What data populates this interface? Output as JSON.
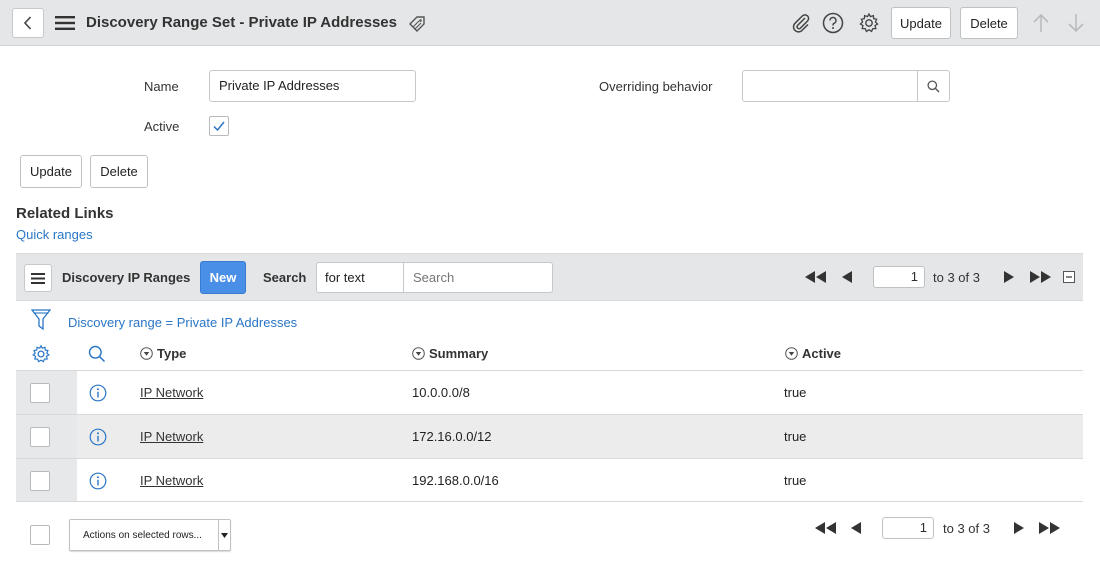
{
  "header": {
    "title": "Discovery Range Set - Private IP Addresses",
    "update_label": "Update",
    "delete_label": "Delete"
  },
  "form": {
    "name_label": "Name",
    "name_value": "Private IP Addresses",
    "active_label": "Active",
    "active_checked": true,
    "overriding_label": "Overriding behavior",
    "overriding_value": "",
    "update_label": "Update",
    "delete_label": "Delete"
  },
  "related": {
    "heading": "Related Links",
    "quick_ranges": "Quick ranges"
  },
  "list": {
    "title": "Discovery IP Ranges",
    "new_label": "New",
    "search_label": "Search",
    "search_field": "for text",
    "search_placeholder": "Search",
    "page_value": "1",
    "page_of": "to 3 of 3",
    "filter_text": "Discovery range = Private IP Addresses",
    "columns": [
      "Type",
      "Summary",
      "Active"
    ],
    "rows": [
      {
        "type": "IP Network",
        "summary": "10.0.0.0/8",
        "active": "true"
      },
      {
        "type": "IP Network",
        "summary": "172.16.0.0/12",
        "active": "true"
      },
      {
        "type": "IP Network",
        "summary": "192.168.0.0/16",
        "active": "true"
      }
    ],
    "actions_label": "Actions on selected rows...",
    "bottom_page_value": "1",
    "bottom_page_of": "to 3 of 3"
  },
  "colors": {
    "accent": "#2a76c6",
    "new_button": "#4a8fe7",
    "header_bg": "#e4e6e7"
  }
}
